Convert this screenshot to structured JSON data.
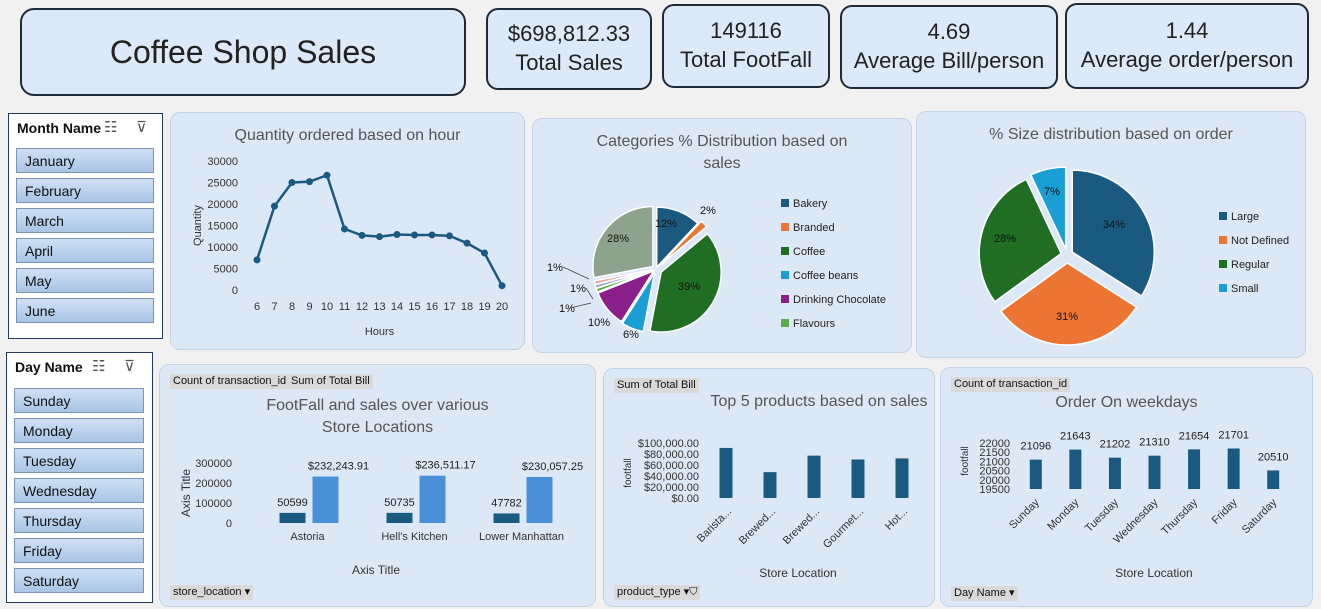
{
  "header": {
    "title": "Coffee Shop Sales",
    "kpis": [
      {
        "value": "$698,812.33",
        "label": "Total Sales"
      },
      {
        "value": "149116",
        "label": "Total FootFall"
      },
      {
        "value": "4.69",
        "label": "Average Bill/person"
      },
      {
        "value": "1.44",
        "label": "Average order/person"
      }
    ]
  },
  "slicers": {
    "month": {
      "title": "Month Name",
      "items": [
        "January",
        "February",
        "March",
        "April",
        "May",
        "June"
      ]
    },
    "day": {
      "title": "Day Name",
      "items": [
        "Sunday",
        "Monday",
        "Tuesday",
        "Wednesday",
        "Thursday",
        "Friday",
        "Saturday"
      ]
    }
  },
  "pivot_tags": {
    "footfall_count": "Count of transaction_id",
    "footfall_sum": "Sum of Total Bill",
    "footfall_filter": "store_location",
    "products_sum": "Sum of Total Bill",
    "products_filter": "product_type",
    "weekday_count": "Count of transaction_id",
    "weekday_filter": "Day Name"
  },
  "colors": {
    "navy": "#1b5a80",
    "light_blue": "#4a90d9",
    "orange": "#ec7533",
    "green": "#1f6e23",
    "cyan": "#1a9fd4",
    "purple": "#8a1f8a",
    "sage": "#8ea38e"
  },
  "chart_data": [
    {
      "id": "hourly",
      "type": "line",
      "title": "Quantity ordered based on hour",
      "xlabel": "Hours",
      "ylabel": "Quantity",
      "x": [
        6,
        7,
        8,
        9,
        10,
        11,
        12,
        13,
        14,
        15,
        16,
        17,
        18,
        19,
        20
      ],
      "values": [
        7000,
        19500,
        25000,
        25200,
        26700,
        14200,
        12700,
        12400,
        12900,
        12800,
        12800,
        12600,
        10900,
        8600,
        1000
      ],
      "yticks": [
        0,
        5000,
        10000,
        15000,
        20000,
        25000,
        30000
      ],
      "ylim": [
        0,
        30000
      ]
    },
    {
      "id": "categories",
      "type": "pie",
      "title": "Categories % Distribution based on sales",
      "slices": [
        {
          "name": "Bakery",
          "value": 12,
          "label": "12%",
          "color": "#1b5a80"
        },
        {
          "name": "Branded",
          "value": 2,
          "label": "2%",
          "color": "#ec7533"
        },
        {
          "name": "Coffee",
          "value": 39,
          "label": "39%",
          "color": "#1f6e23"
        },
        {
          "name": "Coffee beans",
          "value": 6,
          "label": "6%",
          "color": "#1a9fd4"
        },
        {
          "name": "Drinking Chocolate",
          "value": 10,
          "label": "10%",
          "color": "#8a1f8a"
        },
        {
          "name": "Flavours",
          "value": 1,
          "label": "1%",
          "color": "#5aad4a"
        },
        {
          "name": "",
          "value": 1,
          "label": "1%",
          "color": "#9aa9c8"
        },
        {
          "name": "",
          "value": 1,
          "label": "1%",
          "color": "#e8a6a6"
        },
        {
          "name": "",
          "value": 28,
          "label": "28%",
          "color": "#8ea38e"
        }
      ],
      "legend": [
        "Bakery",
        "Branded",
        "Coffee",
        "Coffee beans",
        "Drinking Chocolate",
        "Flavours"
      ]
    },
    {
      "id": "sizes",
      "type": "pie",
      "title": "% Size distribution based on order",
      "slices": [
        {
          "name": "Large",
          "value": 34,
          "label": "34%",
          "color": "#1b5a80"
        },
        {
          "name": "Not Defined",
          "value": 31,
          "label": "31%",
          "color": "#ec7533"
        },
        {
          "name": "Regular",
          "value": 28,
          "label": "28%",
          "color": "#1f6e23"
        },
        {
          "name": "Small",
          "value": 7,
          "label": "7%",
          "color": "#1a9fd4"
        }
      ],
      "legend": [
        "Large",
        "Not Defined",
        "Regular",
        "Small"
      ]
    },
    {
      "id": "stores",
      "type": "bar",
      "title": "FootFall and sales over various Store Locations",
      "categories": [
        "Astoria",
        "Hell's Kitchen",
        "Lower Manhattan"
      ],
      "series": [
        {
          "values": [
            50599,
            50735,
            47782
          ],
          "labels": [
            "50599",
            "50735",
            "47782"
          ],
          "color": "#1b5a80"
        },
        {
          "values": [
            232243.91,
            236511.17,
            230057.25
          ],
          "labels": [
            "$232,243.91",
            "$236,511.17",
            "$230,057.25"
          ],
          "color": "#4a90d9"
        }
      ],
      "xlabel": "Axis Title",
      "ylabel": "Axis Title",
      "yticks": [
        0,
        100000,
        200000,
        300000
      ],
      "ylim": [
        0,
        300000
      ]
    },
    {
      "id": "products",
      "type": "bar",
      "title": "Top 5 products based on sales",
      "categories": [
        "Barista...",
        "Brewed...",
        "Brewed...",
        "Gourmet...",
        "Hot..."
      ],
      "values": [
        91000,
        47000,
        77000,
        70000,
        72000
      ],
      "xlabel": "Store Location",
      "ylabel": "footfall",
      "yticks": [
        0,
        20000,
        40000,
        60000,
        80000,
        100000
      ],
      "ytick_labels": [
        "$0.00",
        "$20,000.00",
        "$40,000.00",
        "$60,000.00",
        "$80,000.00",
        "$100,000.00"
      ],
      "ylim": [
        0,
        100000
      ]
    },
    {
      "id": "weekdays",
      "type": "bar",
      "title": "Order On weekdays",
      "categories": [
        "Sunday",
        "Monday",
        "Tuesday",
        "Wednesday",
        "Thursday",
        "Friday",
        "Saturday"
      ],
      "values": [
        21096,
        21643,
        21202,
        21310,
        21654,
        21701,
        20510
      ],
      "labels": [
        "21096",
        "21643",
        "21202",
        "21310",
        "21654",
        "21701",
        "20510"
      ],
      "xlabel": "Store Location",
      "ylabel": "footfall",
      "yticks": [
        19500,
        20000,
        20500,
        21000,
        21500,
        22000
      ],
      "ylim": [
        19500,
        22000
      ]
    }
  ]
}
